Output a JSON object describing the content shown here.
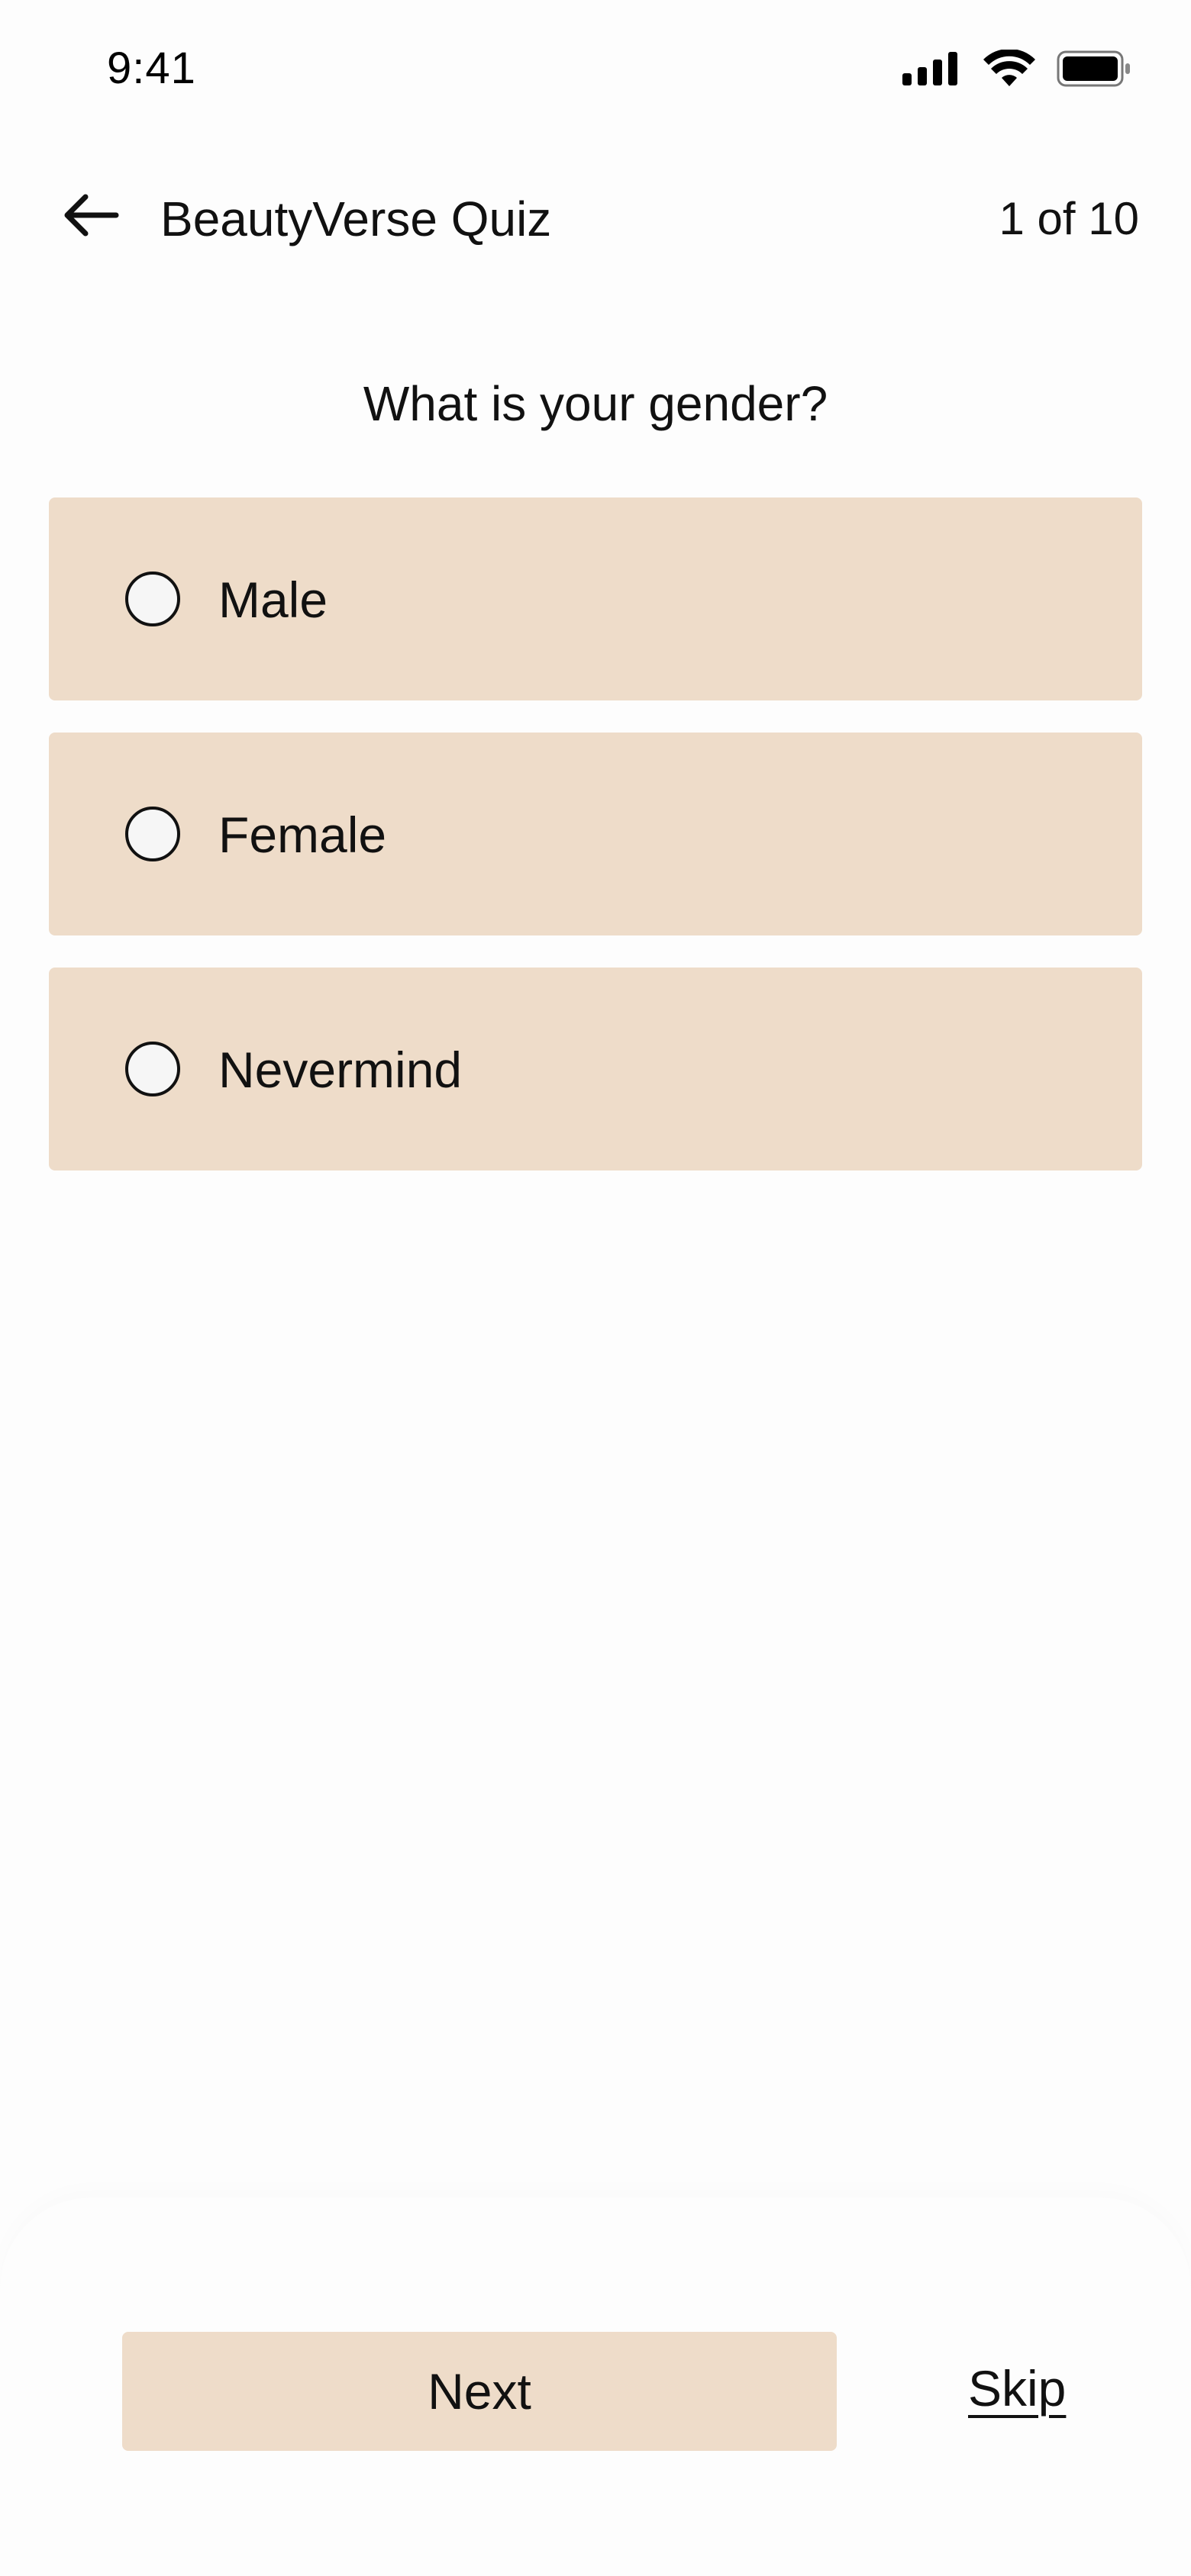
{
  "status_bar": {
    "time": "9:41",
    "icons": [
      "cellular-signal-icon",
      "wifi-icon",
      "battery-icon"
    ]
  },
  "header": {
    "title": "BeautyVerse Quiz",
    "progress": "1 of 10",
    "back_icon": "arrow-left-icon"
  },
  "question": {
    "text": "What is your gender?"
  },
  "options": [
    {
      "label": "Male",
      "selected": false
    },
    {
      "label": "Female",
      "selected": false
    },
    {
      "label": "Nevermind",
      "selected": false
    }
  ],
  "actions": {
    "next_label": "Next",
    "skip_label": "Skip"
  },
  "colors": {
    "option_background": "#EEDCC9",
    "page_background": "#FDFDFD",
    "text": "#111111"
  }
}
